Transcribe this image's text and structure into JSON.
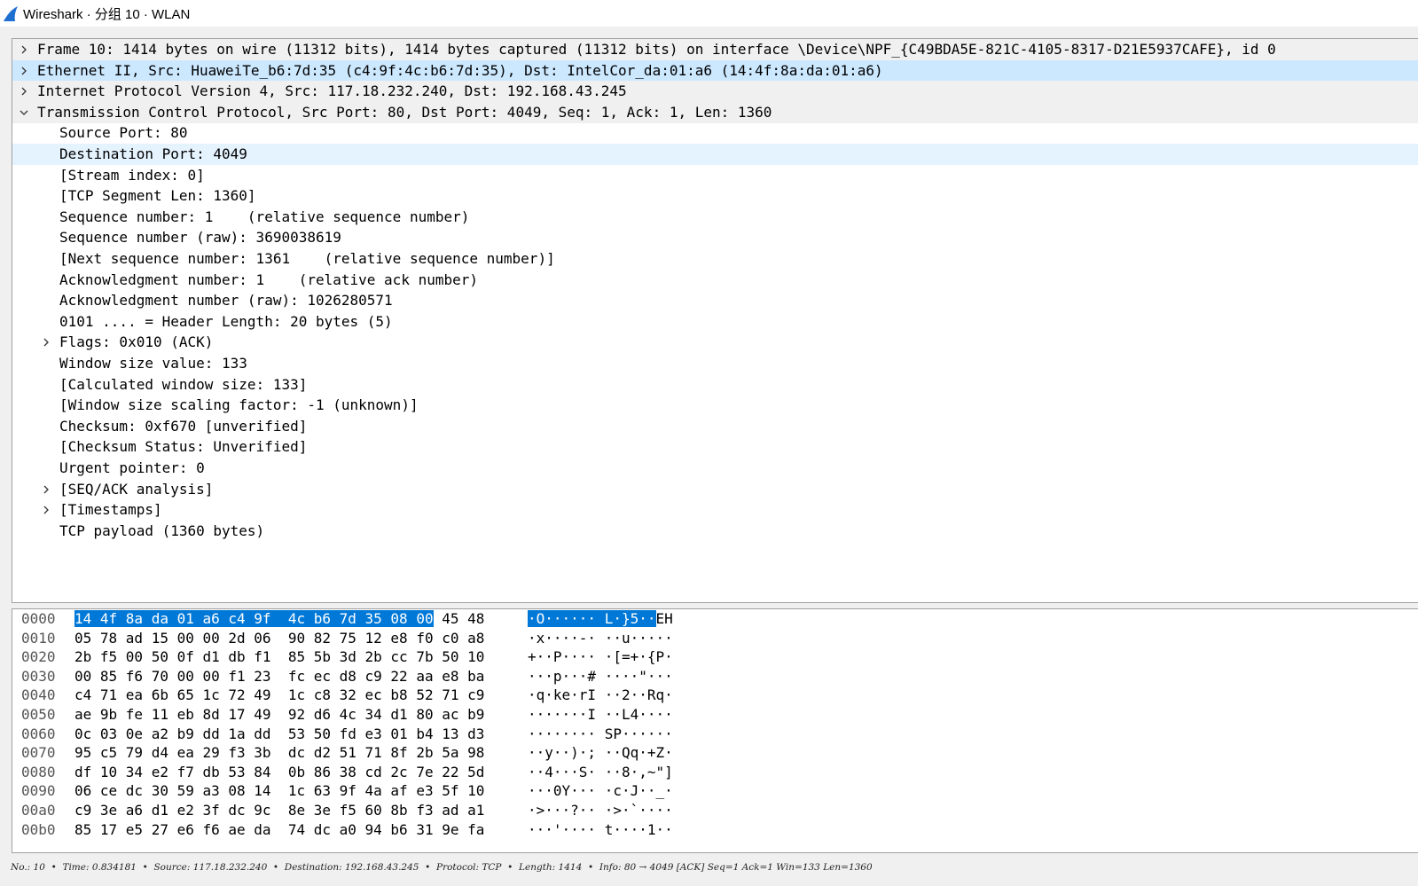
{
  "window": {
    "title": "Wireshark · 分组 10 · WLAN",
    "accent_color": "#1f6fd1"
  },
  "detail_tree": [
    {
      "text": "Frame 10: 1414 bytes on wire (11312 bits), 1414 bytes captured (11312 bits) on interface \\Device\\NPF_{C49BDA5E-821C-4105-8317-D21E5937CAFE}, id 0",
      "level": 0,
      "expander": "collapsed"
    },
    {
      "text": "Ethernet II, Src: HuaweiTe_b6:7d:35 (c4:9f:4c:b6:7d:35), Dst: IntelCor_da:01:a6 (14:4f:8a:da:01:a6)",
      "level": 0,
      "expander": "collapsed",
      "selected": true
    },
    {
      "text": "Internet Protocol Version 4, Src: 117.18.232.240, Dst: 192.168.43.245",
      "level": 0,
      "expander": "collapsed"
    },
    {
      "text": "Transmission Control Protocol, Src Port: 80, Dst Port: 4049, Seq: 1, Ack: 1, Len: 1360",
      "level": 0,
      "expander": "expanded"
    },
    {
      "text": "Source Port: 80",
      "level": 1,
      "expander": "none"
    },
    {
      "text": "Destination Port: 4049",
      "level": 1,
      "expander": "none",
      "hover": true
    },
    {
      "text": "[Stream index: 0]",
      "level": 1,
      "expander": "none"
    },
    {
      "text": "[TCP Segment Len: 1360]",
      "level": 1,
      "expander": "none"
    },
    {
      "text": "Sequence number: 1    (relative sequence number)",
      "level": 1,
      "expander": "none"
    },
    {
      "text": "Sequence number (raw): 3690038619",
      "level": 1,
      "expander": "none"
    },
    {
      "text": "[Next sequence number: 1361    (relative sequence number)]",
      "level": 1,
      "expander": "none"
    },
    {
      "text": "Acknowledgment number: 1    (relative ack number)",
      "level": 1,
      "expander": "none"
    },
    {
      "text": "Acknowledgment number (raw): 1026280571",
      "level": 1,
      "expander": "none"
    },
    {
      "text": "0101 .... = Header Length: 20 bytes (5)",
      "level": 1,
      "expander": "none"
    },
    {
      "text": "Flags: 0x010 (ACK)",
      "level": 1,
      "expander": "collapsed"
    },
    {
      "text": "Window size value: 133",
      "level": 1,
      "expander": "none"
    },
    {
      "text": "[Calculated window size: 133]",
      "level": 1,
      "expander": "none"
    },
    {
      "text": "[Window size scaling factor: -1 (unknown)]",
      "level": 1,
      "expander": "none"
    },
    {
      "text": "Checksum: 0xf670 [unverified]",
      "level": 1,
      "expander": "none"
    },
    {
      "text": "[Checksum Status: Unverified]",
      "level": 1,
      "expander": "none"
    },
    {
      "text": "Urgent pointer: 0",
      "level": 1,
      "expander": "none"
    },
    {
      "text": "[SEQ/ACK analysis]",
      "level": 1,
      "expander": "collapsed"
    },
    {
      "text": "[Timestamps]",
      "level": 1,
      "expander": "collapsed"
    },
    {
      "text": "TCP payload (1360 bytes)",
      "level": 1,
      "expander": "none"
    }
  ],
  "hex_dump": {
    "selection_color": "#0078d7",
    "rows": [
      {
        "offset": "0000",
        "bytes": "14 4f 8a da 01 a6 c4 9f  4c b6 7d 35 08 00 45 48",
        "ascii": "·O······ L·}5··EH",
        "hl_bytes": "14 4f 8a da 01 a6 c4 9f  4c b6 7d 35 08 00",
        "rest_bytes": " 45 48",
        "hl_ascii": "·O······ L·}5··",
        "rest_ascii": "EH"
      },
      {
        "offset": "0010",
        "bytes": "05 78 ad 15 00 00 2d 06  90 82 75 12 e8 f0 c0 a8",
        "ascii": "·x····-· ··u·····"
      },
      {
        "offset": "0020",
        "bytes": "2b f5 00 50 0f d1 db f1  85 5b 3d 2b cc 7b 50 10",
        "ascii": "+··P···· ·[=+·{P·"
      },
      {
        "offset": "0030",
        "bytes": "00 85 f6 70 00 00 f1 23  fc ec d8 c9 22 aa e8 ba",
        "ascii": "···p···# ····\"···"
      },
      {
        "offset": "0040",
        "bytes": "c4 71 ea 6b 65 1c 72 49  1c c8 32 ec b8 52 71 c9",
        "ascii": "·q·ke·rI ··2··Rq·"
      },
      {
        "offset": "0050",
        "bytes": "ae 9b fe 11 eb 8d 17 49  92 d6 4c 34 d1 80 ac b9",
        "ascii": "·······I ··L4····"
      },
      {
        "offset": "0060",
        "bytes": "0c 03 0e a2 b9 dd 1a dd  53 50 fd e3 01 b4 13 d3",
        "ascii": "········ SP······"
      },
      {
        "offset": "0070",
        "bytes": "95 c5 79 d4 ea 29 f3 3b  dc d2 51 71 8f 2b 5a 98",
        "ascii": "··y··)·; ··Qq·+Z·"
      },
      {
        "offset": "0080",
        "bytes": "df 10 34 e2 f7 db 53 84  0b 86 38 cd 2c 7e 22 5d",
        "ascii": "··4···S· ··8·,~\"]"
      },
      {
        "offset": "0090",
        "bytes": "06 ce dc 30 59 a3 08 14  1c 63 9f 4a af e3 5f 10",
        "ascii": "···0Y··· ·c·J··_·"
      },
      {
        "offset": "00a0",
        "bytes": "c9 3e a6 d1 e2 3f dc 9c  8e 3e f5 60 8b f3 ad a1",
        "ascii": "·>···?·· ·>·`····"
      },
      {
        "offset": "00b0",
        "bytes": "85 17 e5 27 e6 f6 ae da  74 dc a0 94 b6 31 9e fa",
        "ascii": "···'···· t····1··"
      }
    ]
  },
  "status_bar": {
    "text": "No.: 10  •  Time: 0.834181  •  Source: 117.18.232.240  •  Destination: 192.168.43.245  •  Protocol: TCP  •  Length: 1414  •  Info: 80 → 4049 [ACK] Seq=1 Ack=1 Win=133 Len=1360"
  }
}
